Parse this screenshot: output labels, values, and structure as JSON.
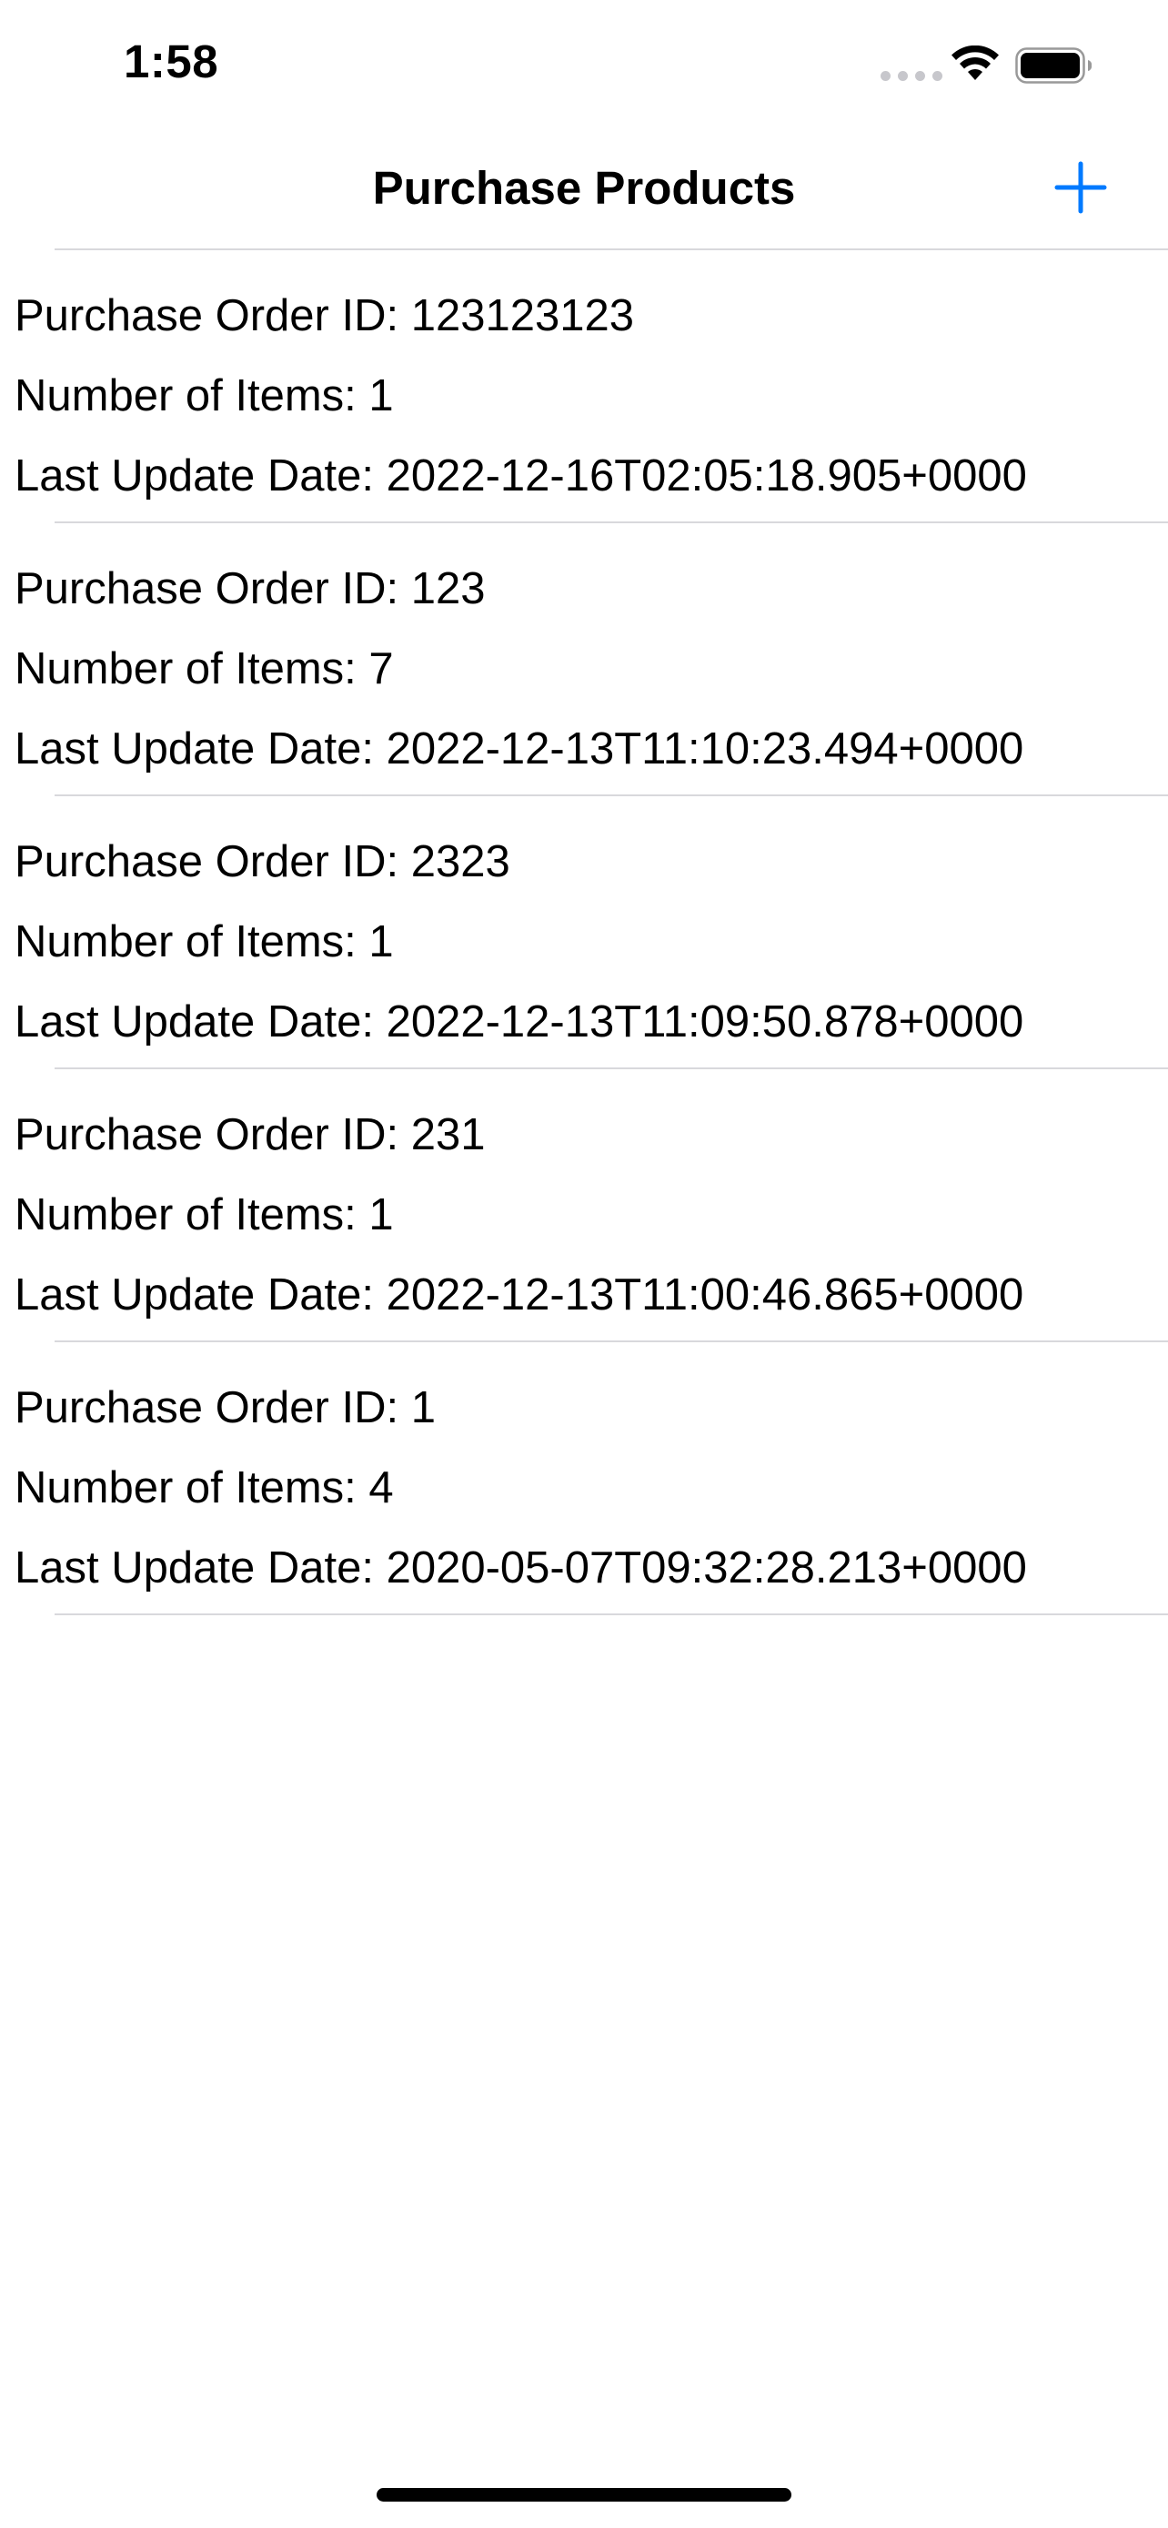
{
  "status_bar": {
    "time": "1:58"
  },
  "nav": {
    "title": "Purchase Products",
    "add_icon": "plus-icon"
  },
  "orders": [
    {
      "id_label": "Purchase Order ID: 123123123",
      "items_label": "Number of Items: 1",
      "date_label": "Last Update Date: 2022-12-16T02:05:18.905+0000"
    },
    {
      "id_label": "Purchase Order ID: 123",
      "items_label": "Number of Items: 7",
      "date_label": "Last Update Date: 2022-12-13T11:10:23.494+0000"
    },
    {
      "id_label": "Purchase Order ID: 2323",
      "items_label": "Number of Items: 1",
      "date_label": "Last Update Date: 2022-12-13T11:09:50.878+0000"
    },
    {
      "id_label": "Purchase Order ID: 231",
      "items_label": "Number of Items: 1",
      "date_label": "Last Update Date: 2022-12-13T11:00:46.865+0000"
    },
    {
      "id_label": "Purchase Order ID: 1",
      "items_label": "Number of Items: 4",
      "date_label": "Last Update Date: 2020-05-07T09:32:28.213+0000"
    }
  ],
  "colors": {
    "accent": "#007aff",
    "separator": "#d8d8dc",
    "text": "#000000",
    "background": "#ffffff"
  }
}
